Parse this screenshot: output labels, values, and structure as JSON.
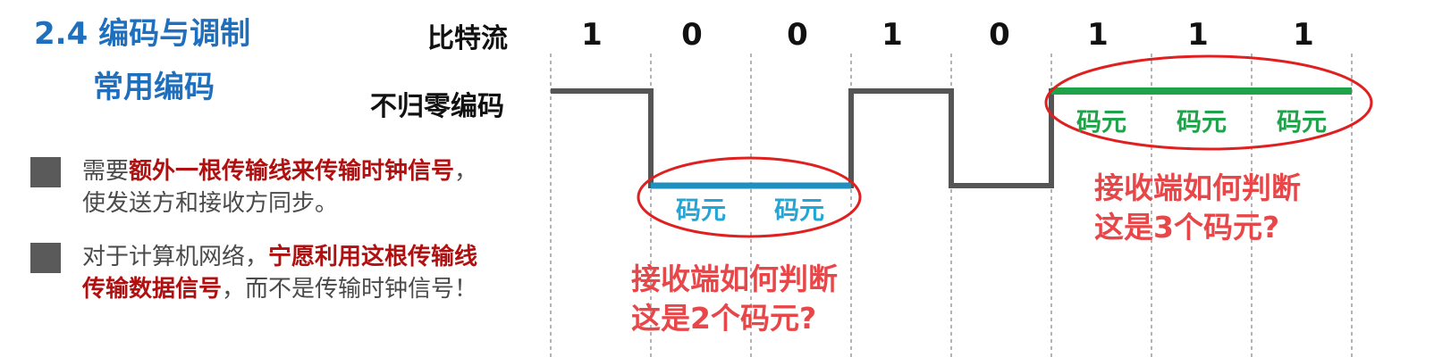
{
  "title": {
    "main": "2.4 编码与调制",
    "sub": "常用编码"
  },
  "bullets": [
    {
      "line1_normal_a": "需要",
      "line1_red": "额外一根传输线来传输时钟信号",
      "line1_normal_b": "，",
      "line2": "使发送方和接收方同步。"
    },
    {
      "line1_normal_a": "对于计算机网络，",
      "line1_red": "宁愿利用这根传输线",
      "line2_red": "传输数据信号",
      "line2_normal": "，而不是传输时钟信号！"
    }
  ],
  "diagram": {
    "bitstream_label": "比特流",
    "encoding_label": "不归零编码",
    "bits": [
      "1",
      "0",
      "0",
      "1",
      "0",
      "1",
      "1",
      "1"
    ],
    "symbol_label": "码元",
    "question_two": [
      "接收端如何判断",
      "这是2个码元?"
    ],
    "question_three": [
      "接收端如何判断",
      "这是3个码元?"
    ]
  },
  "colors": {
    "title": "#1f6fbf",
    "emphasis": "#b01010",
    "signal": "#555555",
    "blue_highlight": "#1f8fc0",
    "green_highlight": "#1fa34a",
    "ellipse": "#e02020",
    "question": "#e8474a"
  }
}
